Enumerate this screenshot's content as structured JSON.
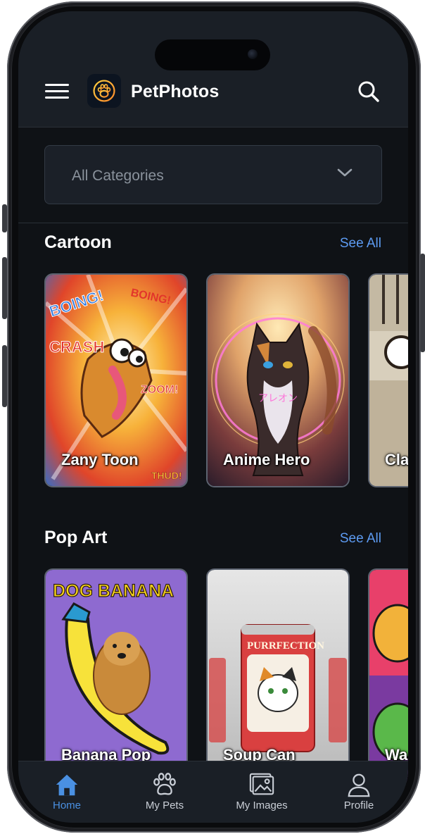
{
  "app": {
    "title": "PetPhotos"
  },
  "filter": {
    "selected": "All Categories"
  },
  "sections": [
    {
      "title": "Cartoon",
      "see_all": "See All",
      "cards": [
        {
          "caption": "Zany Toon"
        },
        {
          "caption": "Anime Hero"
        },
        {
          "caption": "Cla"
        }
      ]
    },
    {
      "title": "Pop Art",
      "see_all": "See All",
      "cards": [
        {
          "caption": "Banana Pop",
          "art_text": "DOG BANANA"
        },
        {
          "caption": "Soup Can",
          "art_text": "PURRFECTION"
        },
        {
          "caption": "Wa"
        }
      ]
    }
  ],
  "tabbar": {
    "items": [
      {
        "label": "Home",
        "icon": "home-icon",
        "active": true
      },
      {
        "label": "My Pets",
        "icon": "paw-icon",
        "active": false
      },
      {
        "label": "My Images",
        "icon": "images-icon",
        "active": false
      },
      {
        "label": "Profile",
        "icon": "profile-icon",
        "active": false
      }
    ]
  },
  "colors": {
    "accent": "#4a90e2",
    "link": "#5d9bf2",
    "background": "#0f1216",
    "bar": "#1a1f26"
  }
}
